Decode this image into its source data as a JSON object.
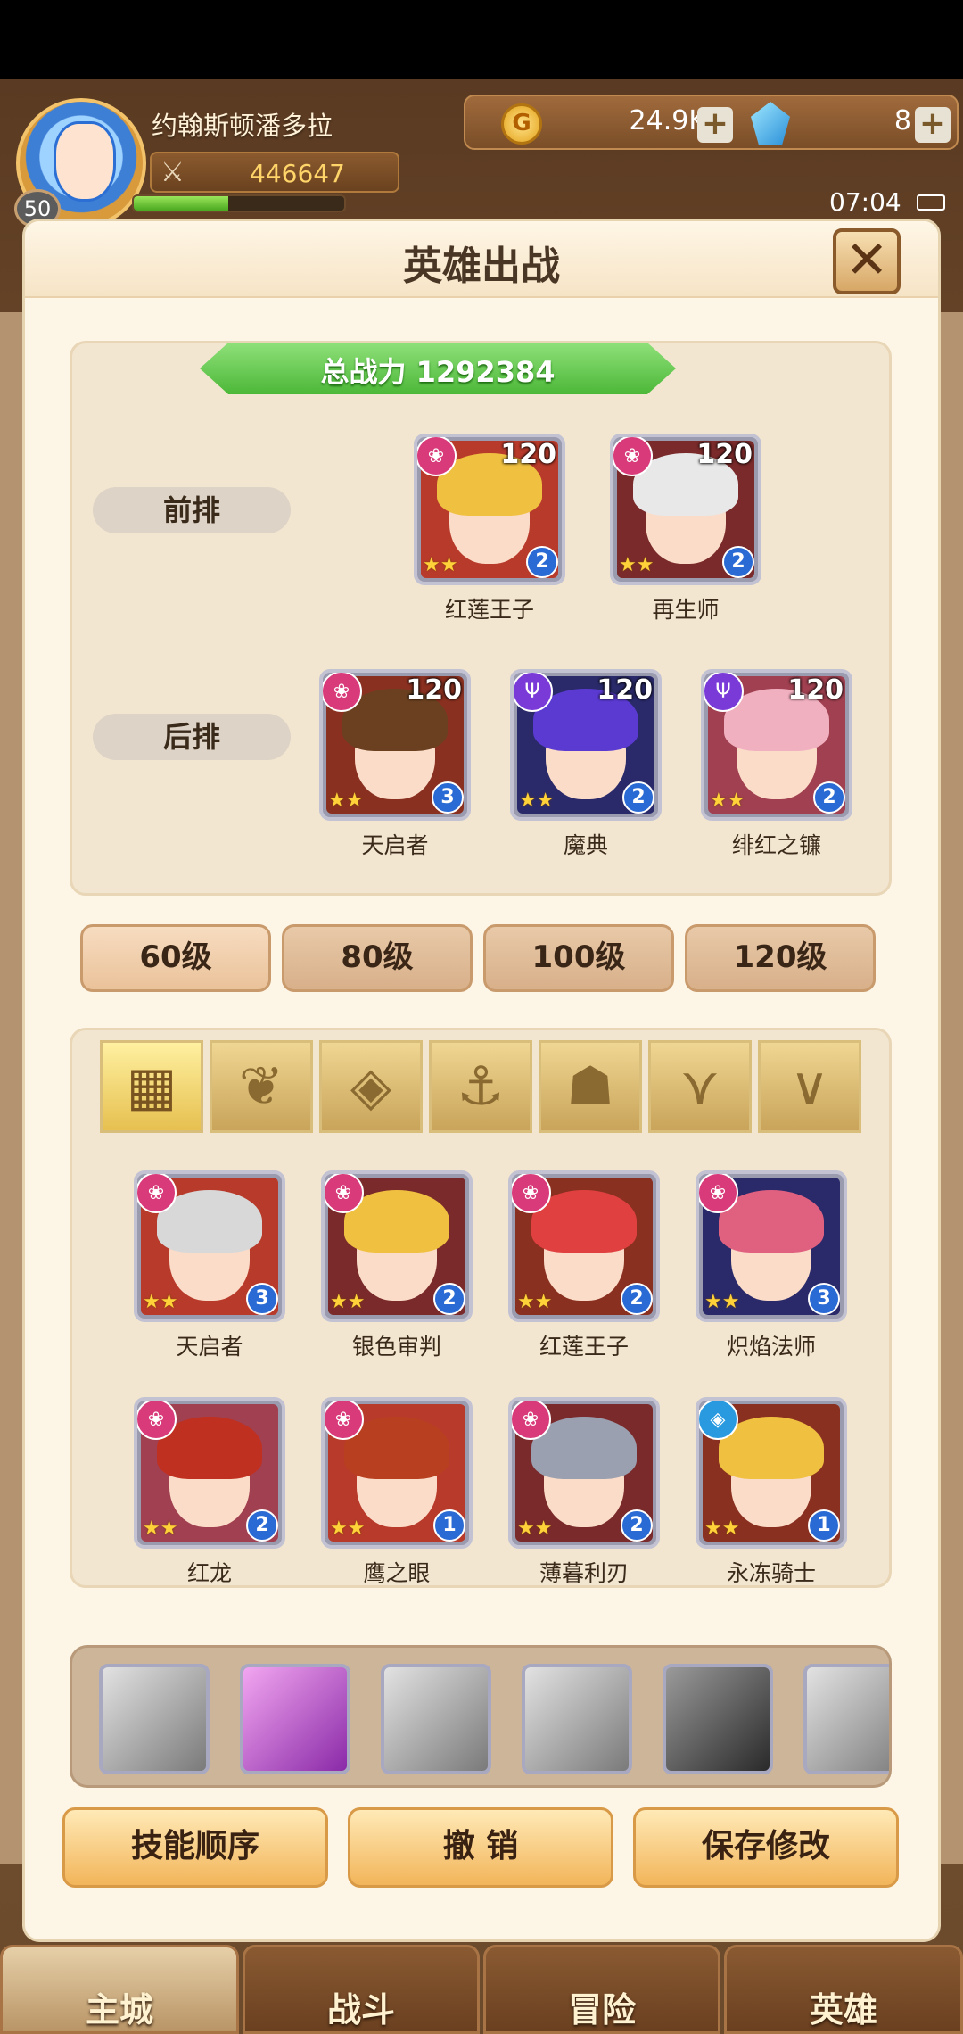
{
  "player": {
    "name": "约翰斯顿潘多拉",
    "level": "50",
    "power": "446647",
    "exp_fraction": 0.45
  },
  "resources": {
    "gold": "24.9K",
    "gems": "8"
  },
  "status": {
    "time": "07:04"
  },
  "dialog": {
    "title": "英雄出战",
    "total_power_text": "总战力   1292384",
    "front_label": "前排",
    "back_label": "后排",
    "front": [
      {
        "name": "红莲王子",
        "level": "120",
        "rank": "2",
        "stars": "★★",
        "faction": "fire"
      },
      {
        "name": "再生师",
        "level": "120",
        "rank": "2",
        "stars": "★★",
        "faction": "fire"
      }
    ],
    "back": [
      {
        "name": "天启者",
        "level": "120",
        "rank": "3",
        "stars": "★★",
        "faction": "fire"
      },
      {
        "name": "魔典",
        "level": "120",
        "rank": "2",
        "stars": "★★",
        "faction": "dark"
      },
      {
        "name": "绯红之镰",
        "level": "120",
        "rank": "2",
        "stars": "★★",
        "faction": "dark"
      }
    ],
    "level_tabs": [
      "60级",
      "80级",
      "100级",
      "120级"
    ],
    "filter_icons": [
      "grid-icon",
      "flame-icon",
      "diamond-icon",
      "anchor-icon",
      "beast-icon",
      "demon-icon",
      "horns-icon"
    ],
    "heroes": [
      {
        "name": "天启者",
        "rank": "3",
        "stars": "★★"
      },
      {
        "name": "银色审判",
        "rank": "2",
        "stars": "★★"
      },
      {
        "name": "红莲王子",
        "rank": "2",
        "stars": "★★"
      },
      {
        "name": "炽焰法师",
        "rank": "3",
        "stars": "★★"
      },
      {
        "name": "红龙",
        "rank": "2",
        "stars": "★★"
      },
      {
        "name": "鹰之眼",
        "rank": "1",
        "stars": "★★"
      },
      {
        "name": "薄暮利刃",
        "rank": "2",
        "stars": "★★"
      },
      {
        "name": "永冻骑士",
        "rank": "1",
        "stars": "★★"
      }
    ],
    "buttons": {
      "skill_order": "技能顺序",
      "cancel": "撤 销",
      "save": "保存修改"
    }
  },
  "nav": [
    "主城",
    "战斗",
    "冒险",
    "英雄"
  ]
}
